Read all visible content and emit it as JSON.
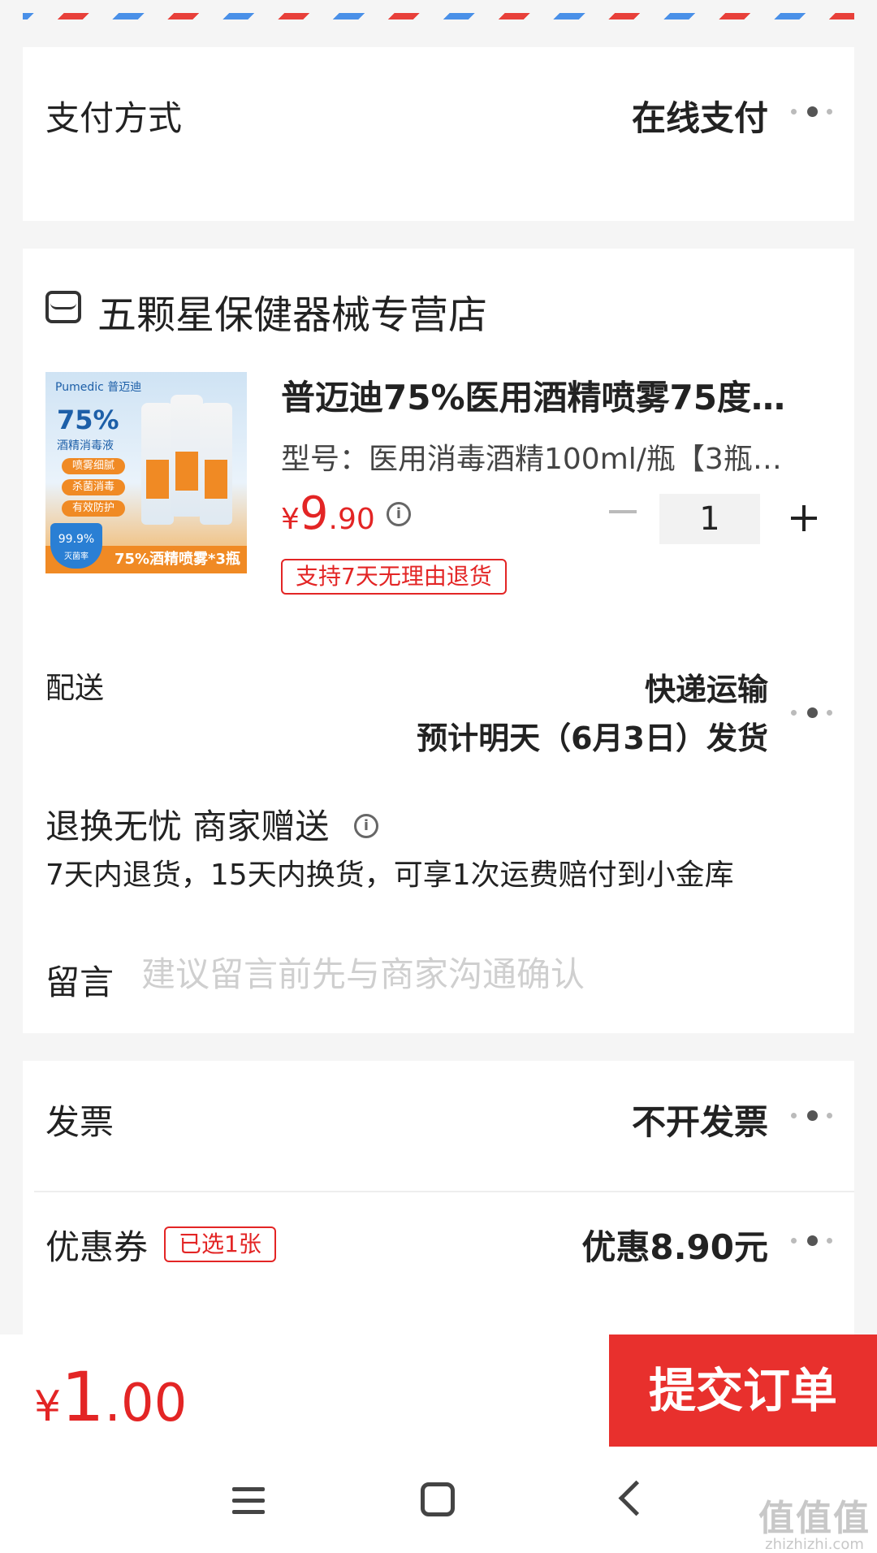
{
  "payment": {
    "label": "支付方式",
    "value": "在线支付"
  },
  "store": {
    "name": "五颗星保健器械专营店"
  },
  "product": {
    "title": "普迈迪75%医用酒精喷雾75度…",
    "spec": "型号：医用消毒酒精100ml/瓶【3瓶…",
    "price_currency": "¥",
    "price_int": "9",
    "price_dec": ".90",
    "quantity": "1",
    "return_badge": "支持7天无理由退货",
    "image": {
      "brand": "Pumedic 普迈迪",
      "headline": "75%",
      "subhead": "酒精消毒液",
      "tags": [
        "喷雾细腻",
        "杀菌消毒",
        "有效防护"
      ],
      "shield": "99.9%",
      "shield_sub": "灭菌率",
      "banner": "75%酒精喷雾*3瓶"
    }
  },
  "shipping": {
    "label": "配送",
    "method": "快递运输",
    "estimate": "预计明天（6月3日）发货"
  },
  "service": {
    "title": "退换无忧 商家赠送",
    "desc": "7天内退货，15天内换货，可享1次运费赔付到小金库"
  },
  "message": {
    "label": "留言",
    "placeholder": "建议留言前先与商家沟通确认"
  },
  "invoice": {
    "label": "发票",
    "value": "不开发票"
  },
  "coupon": {
    "label": "优惠券",
    "badge": "已选1张",
    "value": "优惠8.90元"
  },
  "footer": {
    "total_currency": "¥",
    "total_int": "1",
    "total_dec": ".00",
    "submit_label": "提交订单"
  },
  "watermark": {
    "logo": "值值值",
    "url": "zhizhizhi.com"
  },
  "colors": {
    "accent": "#e32525",
    "submit_bg": "#e8302d",
    "stripe_red": "#e8403a",
    "stripe_blue": "#4a90e8"
  },
  "icons": {
    "more": "more-dots-icon",
    "info": "info-icon",
    "store": "store-icon",
    "nav_menu": "menu-icon",
    "nav_home": "home-icon",
    "nav_back": "back-icon"
  }
}
